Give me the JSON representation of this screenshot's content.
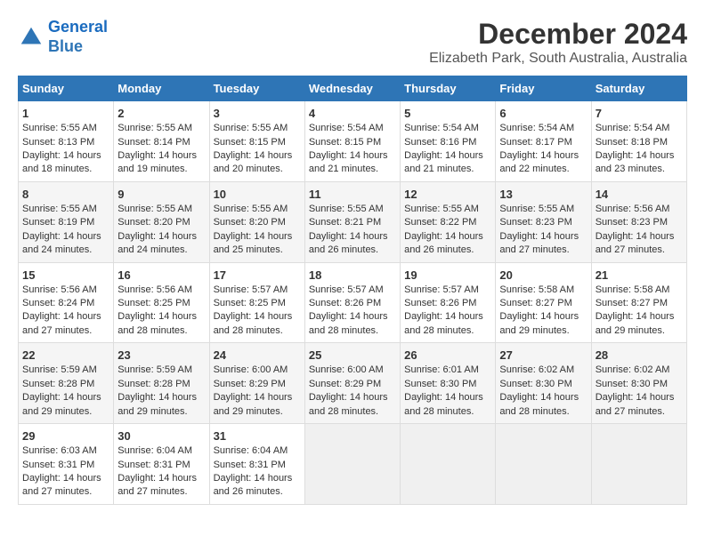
{
  "header": {
    "logo_line1": "General",
    "logo_line2": "Blue",
    "title": "December 2024",
    "subtitle": "Elizabeth Park, South Australia, Australia"
  },
  "calendar": {
    "days_of_week": [
      "Sunday",
      "Monday",
      "Tuesday",
      "Wednesday",
      "Thursday",
      "Friday",
      "Saturday"
    ],
    "weeks": [
      [
        {
          "day": "",
          "empty": true
        },
        {
          "day": "",
          "empty": true
        },
        {
          "day": "",
          "empty": true
        },
        {
          "day": "",
          "empty": true
        },
        {
          "day": "",
          "empty": true
        },
        {
          "day": "",
          "empty": true
        },
        {
          "day": "",
          "empty": true
        }
      ],
      [
        {
          "day": "1",
          "content": "Sunrise: 5:55 AM\nSunset: 8:13 PM\nDaylight: 14 hours\nand 18 minutes."
        },
        {
          "day": "2",
          "content": "Sunrise: 5:55 AM\nSunset: 8:14 PM\nDaylight: 14 hours\nand 19 minutes."
        },
        {
          "day": "3",
          "content": "Sunrise: 5:55 AM\nSunset: 8:15 PM\nDaylight: 14 hours\nand 20 minutes."
        },
        {
          "day": "4",
          "content": "Sunrise: 5:54 AM\nSunset: 8:15 PM\nDaylight: 14 hours\nand 21 minutes."
        },
        {
          "day": "5",
          "content": "Sunrise: 5:54 AM\nSunset: 8:16 PM\nDaylight: 14 hours\nand 21 minutes."
        },
        {
          "day": "6",
          "content": "Sunrise: 5:54 AM\nSunset: 8:17 PM\nDaylight: 14 hours\nand 22 minutes."
        },
        {
          "day": "7",
          "content": "Sunrise: 5:54 AM\nSunset: 8:18 PM\nDaylight: 14 hours\nand 23 minutes."
        }
      ],
      [
        {
          "day": "8",
          "content": "Sunrise: 5:55 AM\nSunset: 8:19 PM\nDaylight: 14 hours\nand 24 minutes."
        },
        {
          "day": "9",
          "content": "Sunrise: 5:55 AM\nSunset: 8:20 PM\nDaylight: 14 hours\nand 24 minutes."
        },
        {
          "day": "10",
          "content": "Sunrise: 5:55 AM\nSunset: 8:20 PM\nDaylight: 14 hours\nand 25 minutes."
        },
        {
          "day": "11",
          "content": "Sunrise: 5:55 AM\nSunset: 8:21 PM\nDaylight: 14 hours\nand 26 minutes."
        },
        {
          "day": "12",
          "content": "Sunrise: 5:55 AM\nSunset: 8:22 PM\nDaylight: 14 hours\nand 26 minutes."
        },
        {
          "day": "13",
          "content": "Sunrise: 5:55 AM\nSunset: 8:23 PM\nDaylight: 14 hours\nand 27 minutes."
        },
        {
          "day": "14",
          "content": "Sunrise: 5:56 AM\nSunset: 8:23 PM\nDaylight: 14 hours\nand 27 minutes."
        }
      ],
      [
        {
          "day": "15",
          "content": "Sunrise: 5:56 AM\nSunset: 8:24 PM\nDaylight: 14 hours\nand 27 minutes."
        },
        {
          "day": "16",
          "content": "Sunrise: 5:56 AM\nSunset: 8:25 PM\nDaylight: 14 hours\nand 28 minutes."
        },
        {
          "day": "17",
          "content": "Sunrise: 5:57 AM\nSunset: 8:25 PM\nDaylight: 14 hours\nand 28 minutes."
        },
        {
          "day": "18",
          "content": "Sunrise: 5:57 AM\nSunset: 8:26 PM\nDaylight: 14 hours\nand 28 minutes."
        },
        {
          "day": "19",
          "content": "Sunrise: 5:57 AM\nSunset: 8:26 PM\nDaylight: 14 hours\nand 28 minutes."
        },
        {
          "day": "20",
          "content": "Sunrise: 5:58 AM\nSunset: 8:27 PM\nDaylight: 14 hours\nand 29 minutes."
        },
        {
          "day": "21",
          "content": "Sunrise: 5:58 AM\nSunset: 8:27 PM\nDaylight: 14 hours\nand 29 minutes."
        }
      ],
      [
        {
          "day": "22",
          "content": "Sunrise: 5:59 AM\nSunset: 8:28 PM\nDaylight: 14 hours\nand 29 minutes."
        },
        {
          "day": "23",
          "content": "Sunrise: 5:59 AM\nSunset: 8:28 PM\nDaylight: 14 hours\nand 29 minutes."
        },
        {
          "day": "24",
          "content": "Sunrise: 6:00 AM\nSunset: 8:29 PM\nDaylight: 14 hours\nand 29 minutes."
        },
        {
          "day": "25",
          "content": "Sunrise: 6:00 AM\nSunset: 8:29 PM\nDaylight: 14 hours\nand 28 minutes."
        },
        {
          "day": "26",
          "content": "Sunrise: 6:01 AM\nSunset: 8:30 PM\nDaylight: 14 hours\nand 28 minutes."
        },
        {
          "day": "27",
          "content": "Sunrise: 6:02 AM\nSunset: 8:30 PM\nDaylight: 14 hours\nand 28 minutes."
        },
        {
          "day": "28",
          "content": "Sunrise: 6:02 AM\nSunset: 8:30 PM\nDaylight: 14 hours\nand 27 minutes."
        }
      ],
      [
        {
          "day": "29",
          "content": "Sunrise: 6:03 AM\nSunset: 8:31 PM\nDaylight: 14 hours\nand 27 minutes."
        },
        {
          "day": "30",
          "content": "Sunrise: 6:04 AM\nSunset: 8:31 PM\nDaylight: 14 hours\nand 27 minutes."
        },
        {
          "day": "31",
          "content": "Sunrise: 6:04 AM\nSunset: 8:31 PM\nDaylight: 14 hours\nand 26 minutes."
        },
        {
          "day": "",
          "empty": true
        },
        {
          "day": "",
          "empty": true
        },
        {
          "day": "",
          "empty": true
        },
        {
          "day": "",
          "empty": true
        }
      ]
    ]
  }
}
